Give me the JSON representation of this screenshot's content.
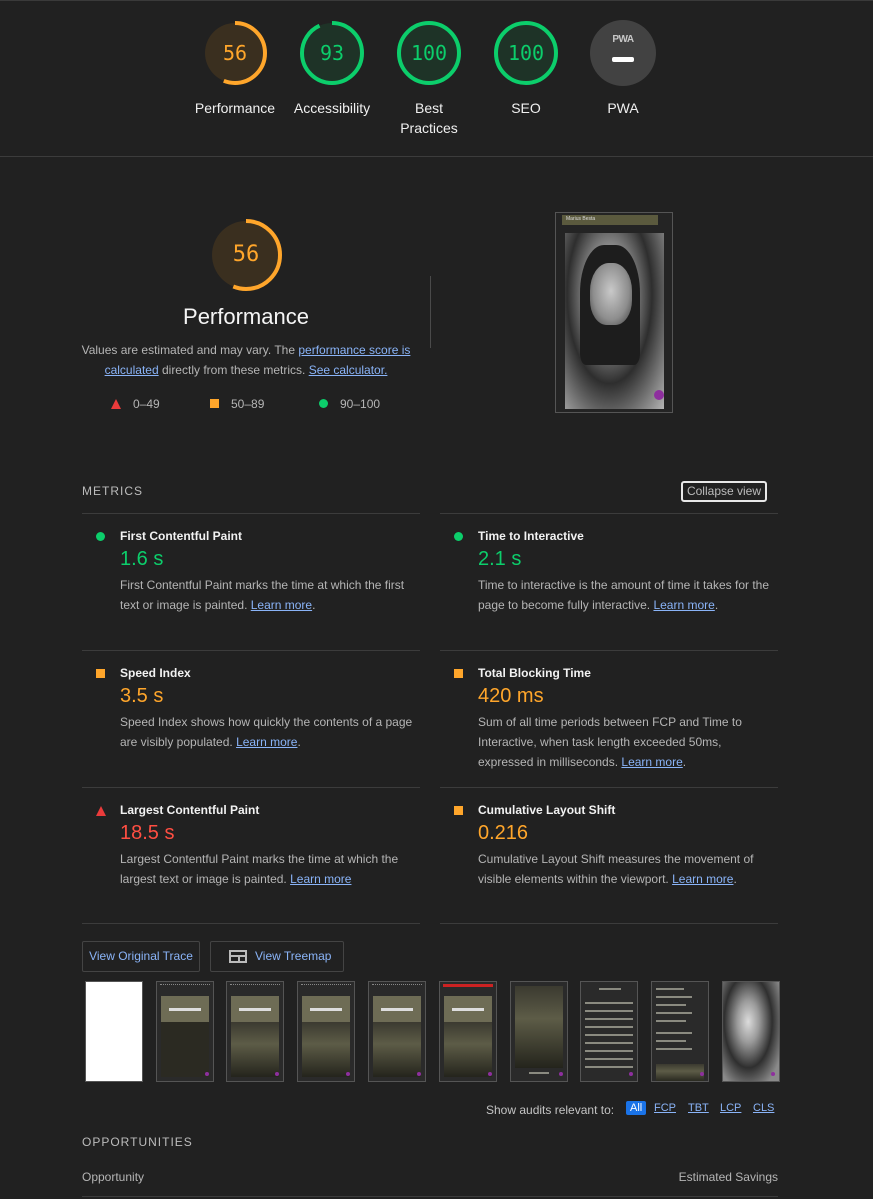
{
  "gauges": [
    {
      "score": "56",
      "label": "Performance",
      "color": "#ffa62b",
      "fraction": 0.56
    },
    {
      "score": "93",
      "label": "Accessibility",
      "color": "#0cce6b",
      "fraction": 0.93
    },
    {
      "score": "100",
      "label": "Best Practices",
      "color": "#0cce6b",
      "fraction": 1.0
    },
    {
      "score": "100",
      "label": "SEO",
      "color": "#0cce6b",
      "fraction": 1.0
    }
  ],
  "pwa": {
    "badge_text": "PWA",
    "label": "PWA"
  },
  "performance": {
    "score": "56",
    "fraction": 0.56,
    "title": "Performance",
    "desc_prefix": "Values are estimated and may vary. The ",
    "desc_link1": "performance score is calculated",
    "desc_middle": " directly from these metrics. ",
    "desc_link2": "See calculator.",
    "legend": [
      {
        "icon": "triangle",
        "range": "0–49"
      },
      {
        "icon": "square",
        "range": "50–89"
      },
      {
        "icon": "circle",
        "range": "90–100"
      }
    ],
    "screenshot_header": "Marius Besta"
  },
  "metrics": {
    "title": "METRICS",
    "collapse_label": "Collapse view",
    "items": [
      {
        "name": "First Contentful Paint",
        "value": "1.6 s",
        "rating": "pass",
        "desc": "First Contentful Paint marks the time at which the first text or image is painted. ",
        "link": "Learn more",
        "tail": "."
      },
      {
        "name": "Time to Interactive",
        "value": "2.1 s",
        "rating": "pass",
        "desc": "Time to interactive is the amount of time it takes for the page to become fully interactive. ",
        "link": "Learn more",
        "tail": "."
      },
      {
        "name": "Speed Index",
        "value": "3.5 s",
        "rating": "average",
        "desc": "Speed Index shows how quickly the contents of a page are visibly populated. ",
        "link": "Learn more",
        "tail": "."
      },
      {
        "name": "Total Blocking Time",
        "value": "420 ms",
        "rating": "average",
        "desc": "Sum of all time periods between FCP and Time to Interactive, when task length exceeded 50ms, expressed in milliseconds. ",
        "link": "Learn more",
        "tail": "."
      },
      {
        "name": "Largest Contentful Paint",
        "value": "18.5 s",
        "rating": "fail",
        "desc": "Largest Contentful Paint marks the time at which the largest text or image is painted. ",
        "link": "Learn more",
        "tail": ""
      },
      {
        "name": "Cumulative Layout Shift",
        "value": "0.216",
        "rating": "average",
        "desc": "Cumulative Layout Shift measures the movement of visible elements within the viewport. ",
        "link": "Learn more",
        "tail": "."
      }
    ]
  },
  "trace": {
    "view_original": "View Original Trace",
    "view_treemap": "View Treemap"
  },
  "filmstrip_count": 10,
  "filter": {
    "label": "Show audits relevant to:",
    "tags": [
      "All",
      "FCP",
      "TBT",
      "LCP",
      "CLS"
    ]
  },
  "opportunities": {
    "title": "OPPORTUNITIES",
    "col_opportunity": "Opportunity",
    "col_savings": "Estimated Savings"
  }
}
